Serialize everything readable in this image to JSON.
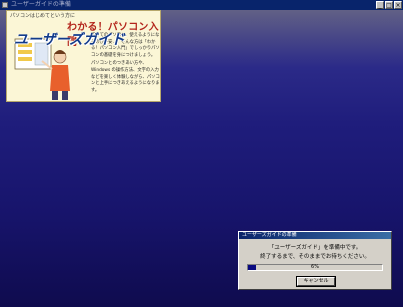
{
  "window": {
    "title": "ユーザーガイドの準備",
    "controls": [
      "_",
      "□",
      "×"
    ]
  },
  "guide": {
    "tagline": "パソコンはじめてという方に",
    "heading": "わかる！パソコン入門",
    "title": "ユーザーズガイド",
    "paragraphs": [
      "初めてのパソコン。使えるようになるのか不安…。そんな方は「わかる！パソコン入門」でしっかりパソコンの基礎を身につけましょう。",
      "パソコンとのつきあい方や、Windows の操作方法、文字の入力などを楽しく体験しながら、パソコンと上手につきあえるようになります。"
    ]
  },
  "dialog": {
    "title": "ユーザーズガイドの準備",
    "message1": "「ユーザーズガイド」を準備中です。",
    "message2": "終了するまで、そのままでお待ちください。",
    "progress": 6,
    "progress_label": "6%",
    "cancel_label": "キャンセル"
  },
  "colors": {
    "desktop_top": "#2b2a88",
    "desktop_bottom": "#0f0b4e",
    "progress_fill": "#0a0a80",
    "heading": "#b3241b",
    "title": "#123b8a"
  }
}
